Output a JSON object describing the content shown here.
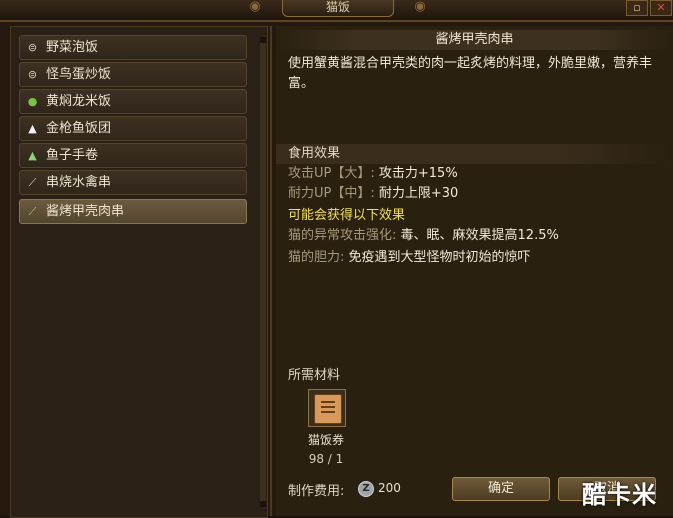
{
  "window": {
    "title": "猫饭",
    "close_glyph": "✕"
  },
  "sidebar": {
    "items": [
      {
        "label": "野菜泡饭",
        "icon": "disc-icon",
        "glyph": "⊜",
        "selected": false
      },
      {
        "label": "怪鸟蛋炒饭",
        "icon": "disc-icon",
        "glyph": "⊜",
        "selected": false
      },
      {
        "label": "黄焖龙米饭",
        "icon": "green-circle-icon",
        "glyph": "●",
        "selected": false
      },
      {
        "label": "金枪鱼饭团",
        "icon": "onigiri-icon",
        "glyph": "▲",
        "selected": false
      },
      {
        "label": "鱼子手卷",
        "icon": "hand-roll-icon",
        "glyph": "▲",
        "selected": false
      },
      {
        "label": "串烧水禽串",
        "icon": "skewer-icon",
        "glyph": "⟋",
        "selected": false
      },
      {
        "label": "酱烤甲壳肉串",
        "icon": "skewer-icon",
        "glyph": "⟋",
        "selected": true
      }
    ]
  },
  "detail": {
    "title": "酱烤甲壳肉串",
    "description": "使用蟹黄酱混合甲壳类的肉一起炙烤的料理，外脆里嫩，营养丰富。",
    "effects_header": "食用效果",
    "effects": [
      {
        "label": "攻击UP【大】:",
        "value": "攻击力+15%"
      },
      {
        "label": "耐力UP【中】:",
        "value": "耐力上限+30"
      }
    ],
    "possible_header": "可能会获得以下效果",
    "possible": [
      {
        "label": "猫的异常攻击强化:",
        "value": "毒、眠、麻效果提高12.5%"
      },
      {
        "label": "猫的胆力:",
        "value": "免疫遇到大型怪物时初始的惊吓"
      }
    ],
    "materials_header": "所需材料",
    "material": {
      "name": "猫饭券",
      "count": "98 / 1",
      "icon": "ticket-icon"
    },
    "cost_label": "制作费用:",
    "cost_value": "200",
    "coin_glyph": "Z",
    "confirm_label": "确定",
    "cancel_label": "取消"
  },
  "watermark": "酷卡米"
}
